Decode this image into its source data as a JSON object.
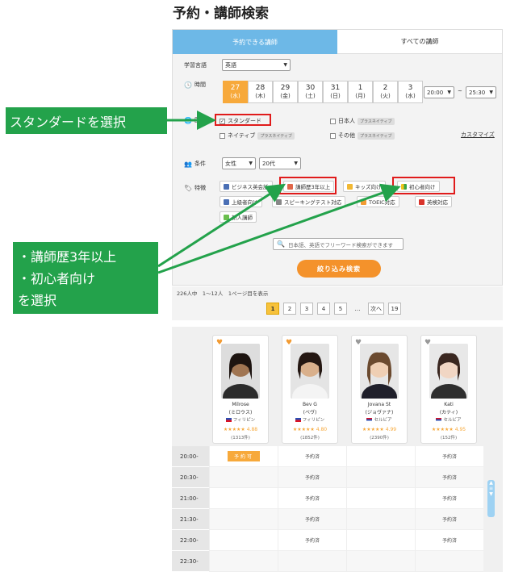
{
  "page": {
    "title": "予約・講師検索"
  },
  "tabs": [
    {
      "label": "予約できる講師",
      "active": true
    },
    {
      "label": "すべての講師",
      "active": false
    }
  ],
  "language": {
    "label": "学習言語",
    "value": "英語"
  },
  "time": {
    "label": "時間",
    "dates": [
      {
        "day": "27",
        "dow": "(水)",
        "selected": true
      },
      {
        "day": "28",
        "dow": "(木)"
      },
      {
        "day": "29",
        "dow": "(金)"
      },
      {
        "day": "30",
        "dow": "(土)"
      },
      {
        "day": "31",
        "dow": "(日)"
      },
      {
        "day": "1",
        "dow": "(月)"
      },
      {
        "day": "2",
        "dow": "(火)"
      },
      {
        "day": "3",
        "dow": "(水)"
      }
    ],
    "from": "20:00",
    "sep": "~",
    "to": "25:30"
  },
  "nationality": {
    "label": "国籍",
    "standard": "スタンダード",
    "japanese": "日本人",
    "native": "ネイティブ",
    "other": "その他",
    "plus_native": "プラスネイティブ",
    "customize": "カスタマイズ"
  },
  "conditions": {
    "label": "条件",
    "gender": "女性",
    "age": "20代"
  },
  "features": {
    "label": "特徴",
    "items": [
      "ビジネス英会話",
      "講師歴3年以上",
      "キッズ向け",
      "初心者向け",
      "上級者向け",
      "スピーキングテスト対応",
      "TOEIC対応",
      "英検対応",
      "新人講師"
    ]
  },
  "search": {
    "placeholder": "日本語、英語でフリーワード検索ができます",
    "submit": "絞り込み検索"
  },
  "results": {
    "count_text": "226人中　1〜12人　1ページ目を表示",
    "pages": [
      "1",
      "2",
      "3",
      "4",
      "5",
      "…",
      "次へ",
      "19"
    ]
  },
  "teachers": [
    {
      "name": "Milrose",
      "kana": "(ミロウス)",
      "country": "フィリピン",
      "rating": "4.88",
      "reviews": "(1313件)"
    },
    {
      "name": "Bev G",
      "kana": "(ベヴ)",
      "country": "フィリピン",
      "rating": "4.80",
      "reviews": "(1852件)"
    },
    {
      "name": "Jovana St",
      "kana": "(ジョヴァナ)",
      "country": "セルビア",
      "rating": "4.99",
      "reviews": "(2390件)"
    },
    {
      "name": "Kati",
      "kana": "(カティ)",
      "country": "セルビア",
      "rating": "4.95",
      "reviews": "(152件)"
    }
  ],
  "schedule": {
    "times": [
      "20:00-",
      "20:30-",
      "21:00-",
      "21:30-",
      "22:00-",
      "22:30-"
    ],
    "available": "予約可",
    "booked": "予約済"
  },
  "callouts": {
    "c1": "スタンダードを選択",
    "c2_line1": "・講師歴3年以上",
    "c2_line2": "・初心者向け",
    "c2_line3": "を選択"
  },
  "colors": {
    "accent_blue": "#6db8e7",
    "orange": "#f4922b",
    "callout_green": "#23a24b",
    "highlight_red": "#e01b1b"
  }
}
